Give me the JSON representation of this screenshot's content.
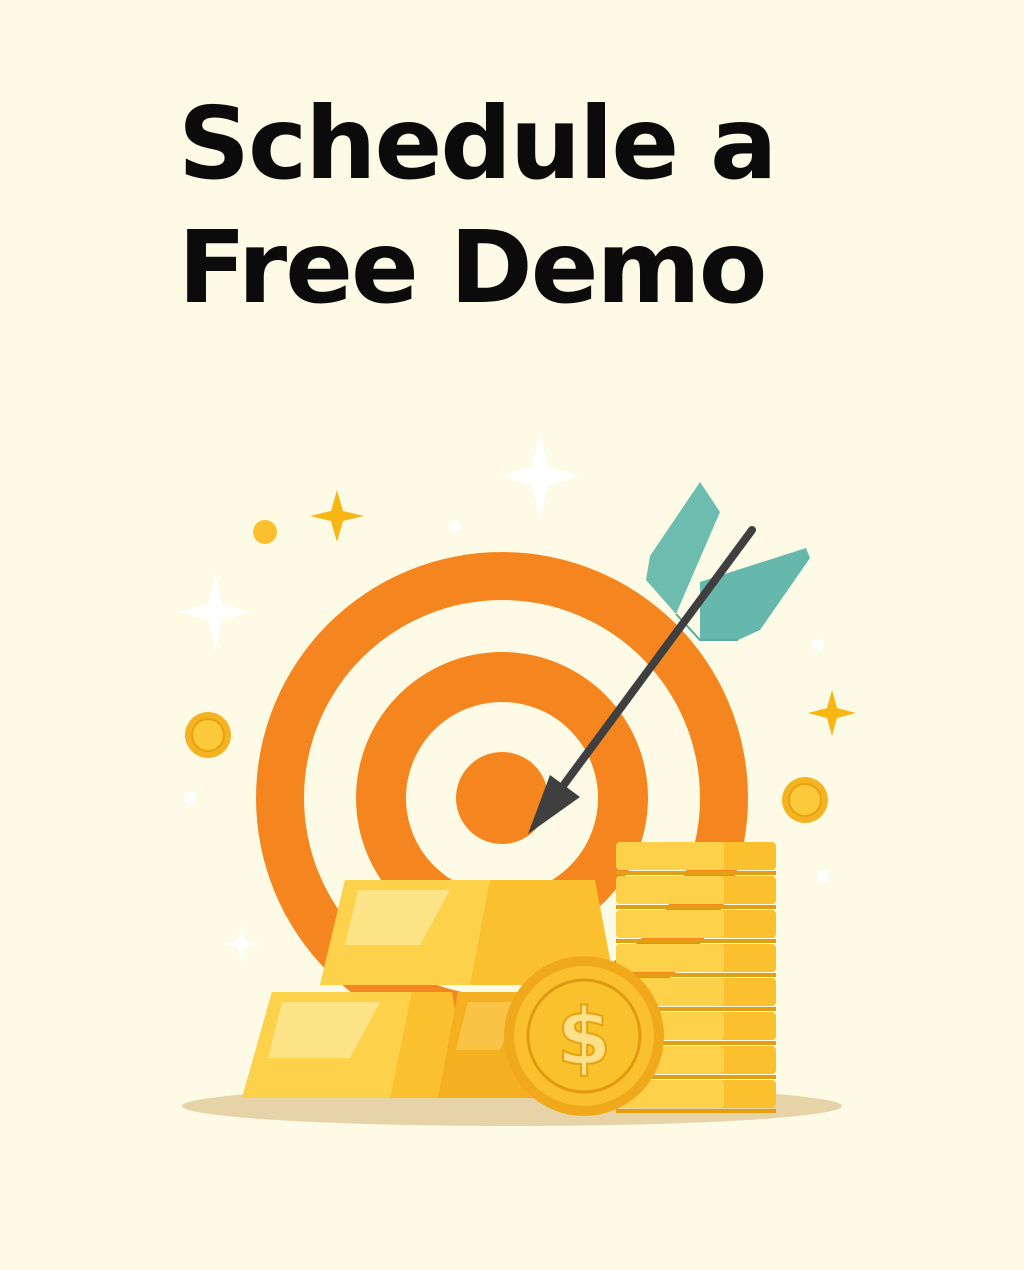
{
  "headline": {
    "line1": "Schedule a",
    "line2": "Free Demo"
  },
  "illustration": {
    "icon": "target-arrow-gold-icon",
    "colors": {
      "background": "#fdfbe6",
      "target_orange": "#f5861f",
      "arrow_teal": "#6cbcb0",
      "gold": "#fbc02d",
      "gold_light": "#fcd755"
    },
    "coin_symbol": "$"
  }
}
